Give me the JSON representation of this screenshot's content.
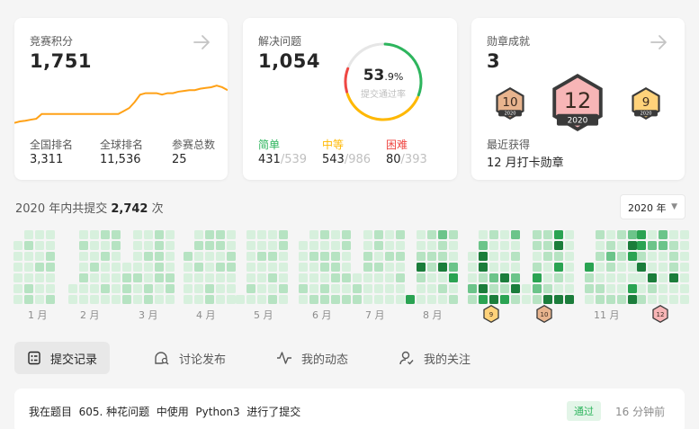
{
  "contest": {
    "title": "竞赛积分",
    "score": "1,751",
    "stats": [
      {
        "label": "全国排名",
        "value": "3,311"
      },
      {
        "label": "全球排名",
        "value": "11,536"
      },
      {
        "label": "参赛总数",
        "value": "25"
      }
    ],
    "rating_series": [
      1500,
      1510,
      1515,
      1522,
      1528,
      1560,
      1560,
      1560,
      1560,
      1560,
      1560,
      1560,
      1560,
      1560,
      1560,
      1560,
      1560,
      1560,
      1560,
      1560,
      1580,
      1600,
      1640,
      1690,
      1700,
      1700,
      1700,
      1690,
      1700,
      1700,
      1710,
      1715,
      1720,
      1720,
      1730,
      1735,
      1740,
      1751,
      1740,
      1720
    ]
  },
  "problems": {
    "title": "解决问题",
    "solved": "1,054",
    "percent_main": "53",
    "percent_dec": ".9%",
    "percent_label": "提交通过率",
    "ring": {
      "easy": 0.3,
      "medium": 0.38,
      "hard": 0.1
    },
    "levels": [
      {
        "label": "简单",
        "solved": "431",
        "total": "/539",
        "color": "#2db55d"
      },
      {
        "label": "中等",
        "solved": "543",
        "total": "/986",
        "color": "#ffb800"
      },
      {
        "label": "困难",
        "solved": "80",
        "total": "/393",
        "color": "#ef4743"
      }
    ]
  },
  "medals": {
    "title": "勋章成就",
    "count": "3",
    "badges": [
      {
        "number": "10",
        "year": "2020",
        "color": "#e8b48e"
      },
      {
        "number": "12",
        "year": "2020",
        "color": "#f7b5b6"
      },
      {
        "number": "9",
        "year": "2020",
        "color": "#ffd27a"
      }
    ],
    "recent_label": "最近获得",
    "recent_value": "12 月打卡勋章"
  },
  "summary": {
    "prefix": "2020 年内共提交",
    "count": "2,742",
    "suffix": "次"
  },
  "year_select": "2020 年",
  "months": [
    "1 月",
    "2 月",
    "3 月",
    "4 月",
    "5 月",
    "6 月",
    "7 月",
    "8 月",
    "11 月"
  ],
  "month_badges": [
    "9",
    "10",
    "12"
  ],
  "tabs": [
    {
      "label": "提交记录",
      "icon": "list-check-icon"
    },
    {
      "label": "讨论发布",
      "icon": "comment-search-icon"
    },
    {
      "label": "我的动态",
      "icon": "activity-icon"
    },
    {
      "label": "我的关注",
      "icon": "user-follow-icon"
    }
  ],
  "record": {
    "text": "我在题目  605. 种花问题  中使用  Python3  进行了提交",
    "status": "通过",
    "time": "16 分钟前"
  },
  "colors": {
    "easy": "#2db55d",
    "medium": "#ffb800",
    "hard": "#ef4743",
    "heat0": "#d7f0dd",
    "heat1": "#b6e3c2",
    "heat2": "#6cc48a",
    "heat3": "#2aa352",
    "heat4": "#1b7d3b"
  }
}
